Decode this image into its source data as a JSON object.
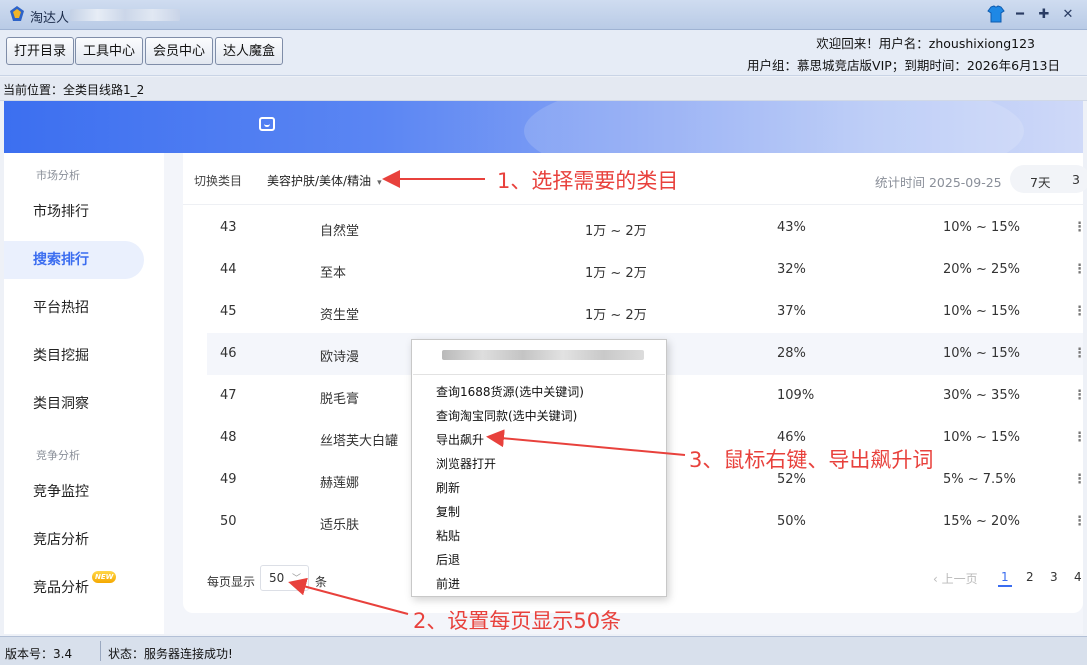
{
  "window": {
    "title": "淘达人"
  },
  "toolbar": {
    "buttons": [
      "打开目录",
      "工具中心",
      "会员中心",
      "达人魔盒"
    ],
    "welcome": "欢迎回来！用户名：zhoushixiong123",
    "usergroup": "用户组：慕思城竞店版VIP；到期时间：2026年6月13日"
  },
  "location": "当前位置：全类目线路1_2",
  "sidebar": {
    "groups": [
      {
        "title": "市场分析",
        "items": [
          "市场排行",
          "搜索排行",
          "平台热招",
          "类目挖掘",
          "类目洞察"
        ]
      },
      {
        "title": "竞争分析",
        "items": [
          "竞争监控",
          "竞店分析",
          "竞品分析"
        ]
      }
    ],
    "active_item": "搜索排行",
    "new_badge": "NEW"
  },
  "content": {
    "switch_label": "切换类目",
    "category": "美容护肤/美体/精油",
    "stat_time": "统计时间 2025-09-25",
    "period_tabs": [
      "7天",
      "3"
    ]
  },
  "table": {
    "rows": [
      {
        "rank": "43",
        "name": "自然堂",
        "v1": "1万 ~ 2万",
        "v2": "43%",
        "v3": "10% ~ 15%"
      },
      {
        "rank": "44",
        "name": "至本",
        "v1": "1万 ~ 2万",
        "v2": "32%",
        "v3": "20% ~ 25%"
      },
      {
        "rank": "45",
        "name": "资生堂",
        "v1": "1万 ~ 2万",
        "v2": "37%",
        "v3": "10% ~ 15%"
      },
      {
        "rank": "46",
        "name": "欧诗漫",
        "v1": "",
        "v2": "28%",
        "v3": "10% ~ 15%"
      },
      {
        "rank": "47",
        "name": "脱毛膏",
        "v1": "",
        "v2": "109%",
        "v3": "30% ~ 35%"
      },
      {
        "rank": "48",
        "name": "丝塔芙大白罐",
        "v1": "",
        "v2": "46%",
        "v3": "10% ~ 15%"
      },
      {
        "rank": "49",
        "name": "赫莲娜",
        "v1": "",
        "v2": "52%",
        "v3": "5% ~ 7.5%"
      },
      {
        "rank": "50",
        "name": "适乐肤",
        "v1": "",
        "v2": "50%",
        "v3": "15% ~ 20%"
      }
    ],
    "more_icon": "⋮"
  },
  "pagination": {
    "per_page_label": "每页显示",
    "per_page_value": "50",
    "per_page_unit": "条",
    "prev": "上一页",
    "pages": [
      "1",
      "2",
      "3",
      "4"
    ],
    "current_page": "1"
  },
  "context_menu": {
    "items": [
      "查询1688货源(选中关键词)",
      "查询淘宝同款(选中关键词)",
      "导出飙升",
      "浏览器打开",
      "刷新",
      "复制",
      "粘贴",
      "后退",
      "前进"
    ]
  },
  "statusbar": {
    "version": "版本号：3.4",
    "message": "状态：服务器连接成功!"
  },
  "annotations": {
    "a1": "1、选择需要的类目",
    "a2": "2、设置每页显示50条",
    "a3": "3、鼠标右键、导出飙升词"
  },
  "colors": {
    "accent": "#3b6df0",
    "annotation": "#e8413c",
    "banner_start": "#3c6ff0",
    "banner_end": "#cfd9f8"
  },
  "icons": {
    "app": "app-logo-icon",
    "skin": "shirt-icon",
    "minimize": "minimize-icon",
    "maximize": "maximize-icon",
    "close": "close-icon",
    "banner": "message-icon",
    "chevron": "chevron-down-icon",
    "more": "more-vertical-icon"
  }
}
